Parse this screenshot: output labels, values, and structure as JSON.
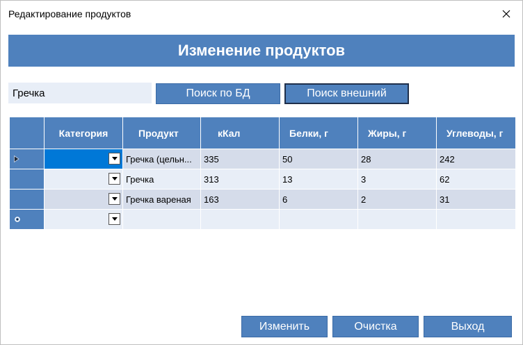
{
  "window": {
    "title": "Редактирование продуктов"
  },
  "header": {
    "title": "Изменение продуктов"
  },
  "search": {
    "value": "Гречка"
  },
  "buttons": {
    "search_db": "Поиск по БД",
    "search_external": "Поиск внешний",
    "edit": "Изменить",
    "clear": "Очистка",
    "exit": "Выход"
  },
  "table": {
    "columns": [
      "Категория",
      "Продукт",
      "кКал",
      "Белки, г",
      "Жиры, г",
      "Углеводы, г"
    ],
    "rows": [
      {
        "category": "",
        "product": "Гречка (цельн...",
        "kcal": "335",
        "protein": "50",
        "fat": "28",
        "carbs": "242"
      },
      {
        "category": "",
        "product": "Гречка",
        "kcal": "313",
        "protein": "13",
        "fat": "3",
        "carbs": "62"
      },
      {
        "category": "",
        "product": "Гречка вареная",
        "kcal": "163",
        "protein": "6",
        "fat": "2",
        "carbs": "31"
      }
    ]
  },
  "colors": {
    "accent": "#4f81bd",
    "row_alt": "#d5dcea",
    "row_light": "#e8eef7",
    "selection": "#0078d7"
  }
}
